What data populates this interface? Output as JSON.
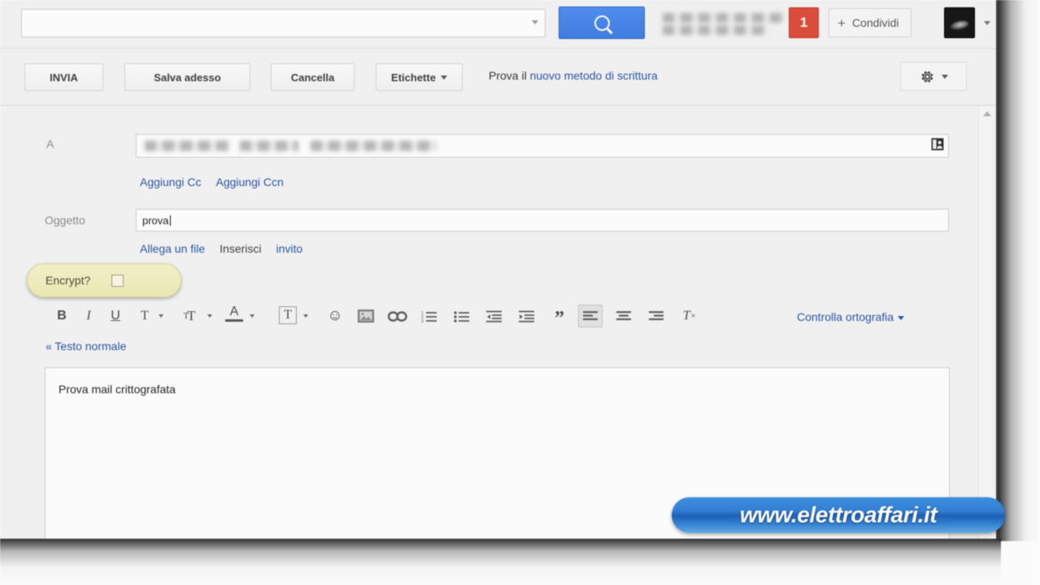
{
  "window": {
    "app": "Gmail compose window (Italian)"
  },
  "topbar": {
    "search_placeholder": "",
    "search_value": "",
    "search_button_icon": "search-icon",
    "account_redacted": true,
    "notification_count": "1",
    "share_label": "Condividi",
    "share_plus": "+",
    "avatar_label": ""
  },
  "actionbar": {
    "send_label": "INVIA",
    "save_label": "Salva adesso",
    "discard_label": "Cancella",
    "labels_label": "Etichette",
    "new_mode_prefix": "Prova il ",
    "new_mode_link": "nuovo metodo di scrittura",
    "settings_icon": "gear-icon"
  },
  "compose": {
    "to_label": "A",
    "to_value": "",
    "contacts_icon": "contacts-icon",
    "cc_link": "Aggiungi Cc",
    "bcc_link": "Aggiungi Ccn",
    "subject_label": "Oggetto",
    "subject_value": "prova",
    "attach_link": "Allega un file",
    "invite_link_dark": "Inserisci",
    "invite_link": "invito",
    "plain_text_link": "« Testo normale",
    "spellcheck_link": "Controlla ortografia",
    "body_text": "Prova mail crittografata"
  },
  "encrypt_tooltip": {
    "label": "Encrypt?",
    "checked": false,
    "background": "#f1ecc0"
  },
  "format_toolbar": {
    "items": [
      {
        "name": "bold-icon",
        "glyph": "B",
        "caret": false,
        "active": false
      },
      {
        "name": "italic-icon",
        "glyph": "I",
        "caret": false,
        "active": false
      },
      {
        "name": "underline-icon",
        "glyph": "U",
        "caret": false,
        "active": false
      },
      {
        "name": "font-family-icon",
        "glyph": "T",
        "caret": true,
        "active": false
      },
      {
        "name": "font-size-icon",
        "glyph": "ᴛᴛ",
        "caret": true,
        "active": false
      },
      {
        "name": "text-color-icon",
        "glyph": "A",
        "caret": true,
        "active": false
      },
      {
        "name": "text-background-icon",
        "glyph": "T",
        "caret": true,
        "active": false
      },
      {
        "name": "emoji-icon",
        "glyph": "☺",
        "caret": false,
        "active": false
      },
      {
        "name": "insert-image-icon",
        "glyph": "▣",
        "caret": false,
        "active": false
      },
      {
        "name": "insert-link-icon",
        "glyph": "∞",
        "caret": false,
        "active": false
      },
      {
        "name": "numbered-list-icon",
        "glyph": "",
        "caret": false,
        "active": false
      },
      {
        "name": "bulleted-list-icon",
        "glyph": "",
        "caret": false,
        "active": false
      },
      {
        "name": "indent-less-icon",
        "glyph": "",
        "caret": false,
        "active": false
      },
      {
        "name": "indent-more-icon",
        "glyph": "",
        "caret": false,
        "active": false
      },
      {
        "name": "quote-icon",
        "glyph": "”",
        "caret": false,
        "active": false
      },
      {
        "name": "align-left-icon",
        "glyph": "",
        "caret": false,
        "active": true
      },
      {
        "name": "align-center-icon",
        "glyph": "",
        "caret": false,
        "active": false
      },
      {
        "name": "align-right-icon",
        "glyph": "",
        "caret": false,
        "active": false
      },
      {
        "name": "remove-formatting-icon",
        "glyph": "Tₓ",
        "caret": false,
        "active": false
      }
    ]
  },
  "watermark": {
    "text": "www.elettroaffari.it",
    "color": "#ffffff",
    "background": "#2f7ed6"
  },
  "colors": {
    "accent_blue": "#3f7ce4",
    "link_blue": "#2a55a2",
    "badge_red": "#dd4b39",
    "tooltip_yellow": "#f1ecc0",
    "chrome_gray": "#f3f3f3"
  }
}
